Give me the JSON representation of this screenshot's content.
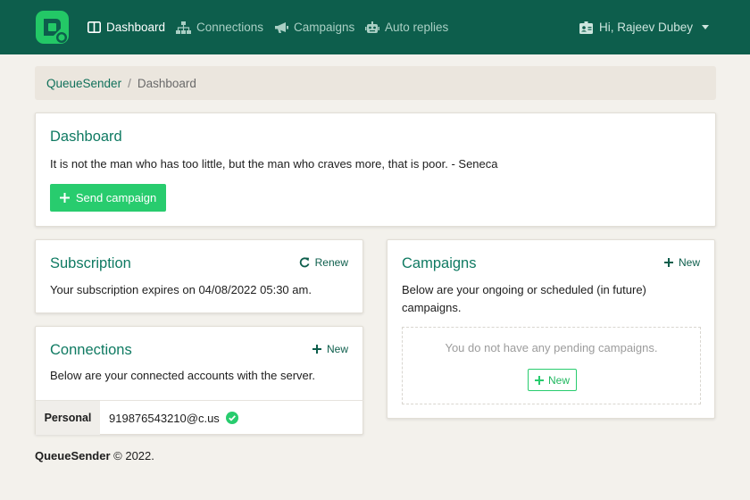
{
  "nav": {
    "items": [
      {
        "label": "Dashboard",
        "icon": "columns-icon",
        "active": true
      },
      {
        "label": "Connections",
        "icon": "sitemap-icon",
        "active": false
      },
      {
        "label": "Campaigns",
        "icon": "megaphone-icon",
        "active": false
      },
      {
        "label": "Auto replies",
        "icon": "robot-icon",
        "active": false
      }
    ],
    "user_label": "Hi, Rajeev Dubey"
  },
  "breadcrumb": {
    "home": "QueueSender",
    "separator": "/",
    "current": "Dashboard"
  },
  "dashboard": {
    "title": "Dashboard",
    "quote": "It is not the man who has too little, but the man who craves more, that is poor. - Seneca",
    "send_button": "Send campaign"
  },
  "subscription": {
    "title": "Subscription",
    "action": "Renew",
    "text": "Your subscription expires on 04/08/2022 05:30 am."
  },
  "connections": {
    "title": "Connections",
    "action": "New",
    "text": "Below are your connected accounts with the server.",
    "accounts": [
      {
        "label": "Personal",
        "value": "919876543210@c.us",
        "status": "connected"
      }
    ]
  },
  "campaigns": {
    "title": "Campaigns",
    "action": "New",
    "text": "Below are your ongoing or scheduled (in future) campaigns.",
    "empty_text": "You do not have any pending campaigns.",
    "empty_button": "New"
  },
  "footer": {
    "brand": "QueueSender",
    "copyright": "© 2022."
  },
  "colors": {
    "navbar": "#0d5e4c",
    "accent": "#28cc6e",
    "title": "#0f7a62",
    "background": "#f3f1ec"
  }
}
